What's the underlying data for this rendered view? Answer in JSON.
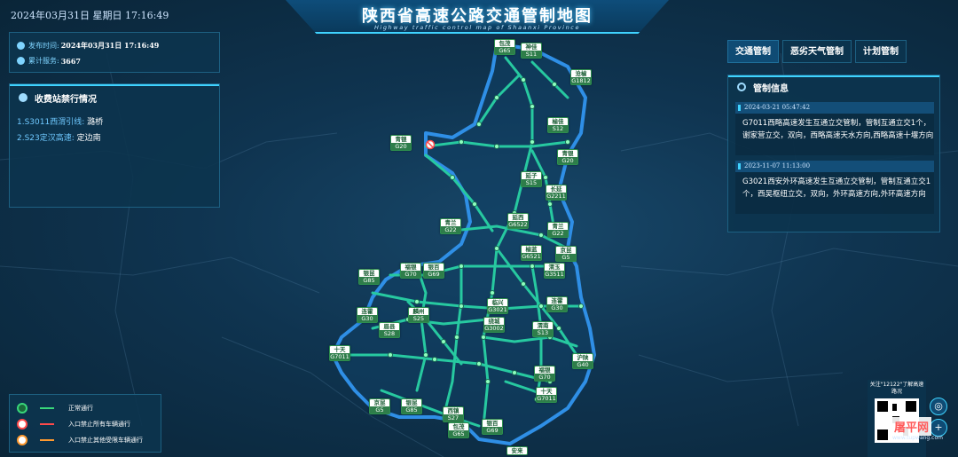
{
  "header": {
    "datetime": "2024年03月31日 星期日  17:16:49",
    "title": "陕西省高速公路交通管制地图",
    "subtitle": "Highway traffic control map of Shaanxi Province"
  },
  "info": {
    "publish_label": "发布时间:",
    "publish_value": "2024年03月31日 17:16:49",
    "service_label": "累计服务:",
    "service_value": "3667"
  },
  "toll": {
    "title": "收费站禁行情况",
    "items": [
      {
        "code": "1.S3011西渭引线:",
        "name": "潞桥"
      },
      {
        "code": "2.S23定汉高速:",
        "name": "定边南"
      }
    ]
  },
  "tabs": [
    "交通管制",
    "恶劣天气管制",
    "计划管制"
  ],
  "control": {
    "title": "管制信息",
    "notices": [
      {
        "time": "2024-03-21 05:47:42",
        "text": "G7011西略高速发生互通立交管制，管制互通立交1个，谢家营立交，双向，西略高速天水方向,西略高速十堰方向"
      },
      {
        "time": "2023-11-07 11:13:00",
        "text": "G3021西安外环高速发生互通立交管制，管制互通立交1个，西吴枢纽立交，双向，外环高速方向,外环高速方向"
      }
    ]
  },
  "legend": [
    {
      "label": "正常通行",
      "color": "#39d67a"
    },
    {
      "label": "入口禁止所有车辆通行",
      "color": "#ff4a4a"
    },
    {
      "label": "入口禁止其他受限车辆通行",
      "color": "#ff9a30"
    }
  ],
  "routes": [
    {
      "name": "包茂",
      "code": "G65"
    },
    {
      "name": "神佳",
      "code": "S11"
    },
    {
      "name": "沧榆",
      "code": "G1812"
    },
    {
      "name": "榆佳",
      "code": "S12"
    },
    {
      "name": "青银",
      "code": "G20"
    },
    {
      "name": "青银",
      "code": "G20"
    },
    {
      "name": "延子",
      "code": "S15"
    },
    {
      "name": "长延",
      "code": "G2211"
    },
    {
      "name": "延西",
      "code": "G6522"
    },
    {
      "name": "青兰",
      "code": "G22"
    },
    {
      "name": "青兰",
      "code": "G22"
    },
    {
      "name": "榆蓝",
      "code": "G6521"
    },
    {
      "name": "京昆",
      "code": "G5"
    },
    {
      "name": "渭玉",
      "code": "G3511"
    },
    {
      "name": "银昆",
      "code": "G85"
    },
    {
      "name": "福银",
      "code": "G70"
    },
    {
      "name": "银百",
      "code": "G69"
    },
    {
      "name": "临兴",
      "code": "G3021"
    },
    {
      "name": "连霍",
      "code": "G30"
    },
    {
      "name": "连霍",
      "code": "G30"
    },
    {
      "name": "麟州",
      "code": "S25"
    },
    {
      "name": "眉县",
      "code": "S28"
    },
    {
      "name": "绕城",
      "code": "G3002"
    },
    {
      "name": "渭南",
      "code": "S13"
    },
    {
      "name": "十天",
      "code": "G7011"
    },
    {
      "name": "沪陕",
      "code": "G40"
    },
    {
      "name": "福银",
      "code": "G70"
    },
    {
      "name": "十天",
      "code": "G7011"
    },
    {
      "name": "京昆",
      "code": "G5"
    },
    {
      "name": "银昆",
      "code": "G85"
    },
    {
      "name": "西镇",
      "code": "S27"
    },
    {
      "name": "包茂",
      "code": "G65"
    },
    {
      "name": "银百",
      "code": "G69"
    },
    {
      "name": "安来",
      "code": ""
    }
  ],
  "qr": {
    "text": "关注\"12122\"了解高速路况"
  },
  "watermark": {
    "brand": "屠平网",
    "url": "www.tupwang.com"
  },
  "colors": {
    "accent": "#3fd3ff",
    "road": "#27c9a0",
    "node": "#8effc0"
  }
}
